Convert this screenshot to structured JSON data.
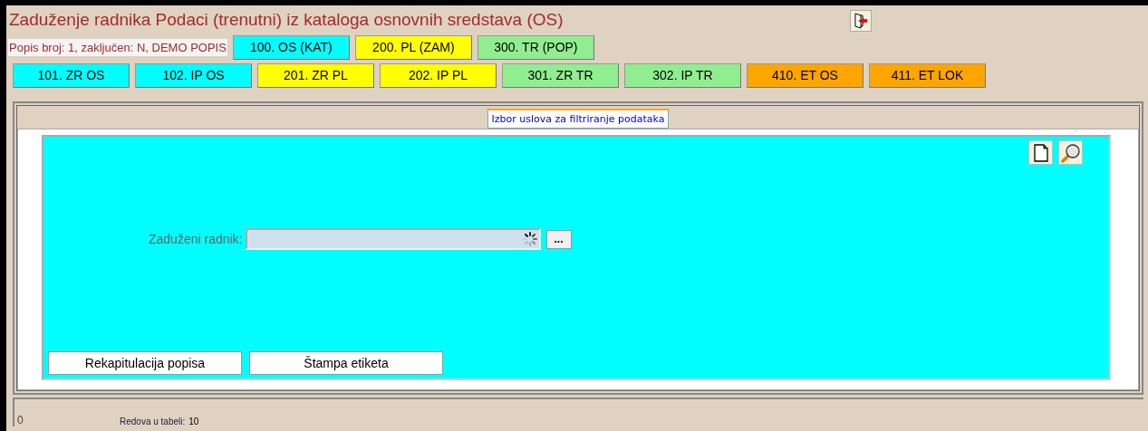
{
  "window": {
    "title": "Zaduženje radnika Podaci (trenutni) iz kataloga osnovnih sredstava (OS)"
  },
  "popis_info": "Popis broj: 1, zaključen: N, DEMO POPIS",
  "group_buttons": [
    {
      "label": "100. OS (KAT)",
      "color": "#00ffff"
    },
    {
      "label": "200. PL (ZAM)",
      "color": "#ffff00"
    },
    {
      "label": "300. TR (POP)",
      "color": "#90ee90"
    }
  ],
  "action_buttons": [
    {
      "label": "101. ZR OS",
      "color": "#00ffff"
    },
    {
      "label": "102. IP OS",
      "color": "#00ffff"
    },
    {
      "label": "201. ZR PL",
      "color": "#ffff00"
    },
    {
      "label": "202. IP PL",
      "color": "#ffff00"
    },
    {
      "label": "301. ZR TR",
      "color": "#90ee90"
    },
    {
      "label": "302. IP TR",
      "color": "#90ee90"
    },
    {
      "label": "410. ET OS",
      "color": "#ffa500"
    },
    {
      "label": "411. ET LOK",
      "color": "#ffa500"
    }
  ],
  "tabs": [
    {
      "label": "Izbor uslova za filtriranje podataka",
      "selected": true
    }
  ],
  "filter": {
    "label": "Zaduženi radnik:",
    "browse_button": "..."
  },
  "bottom_buttons": [
    "Rekapitulacija popisa",
    "Štampa etiketa"
  ],
  "status_bar": {
    "count": "0",
    "rows_label": "Redova u tabeli:",
    "rows_value": "10"
  }
}
